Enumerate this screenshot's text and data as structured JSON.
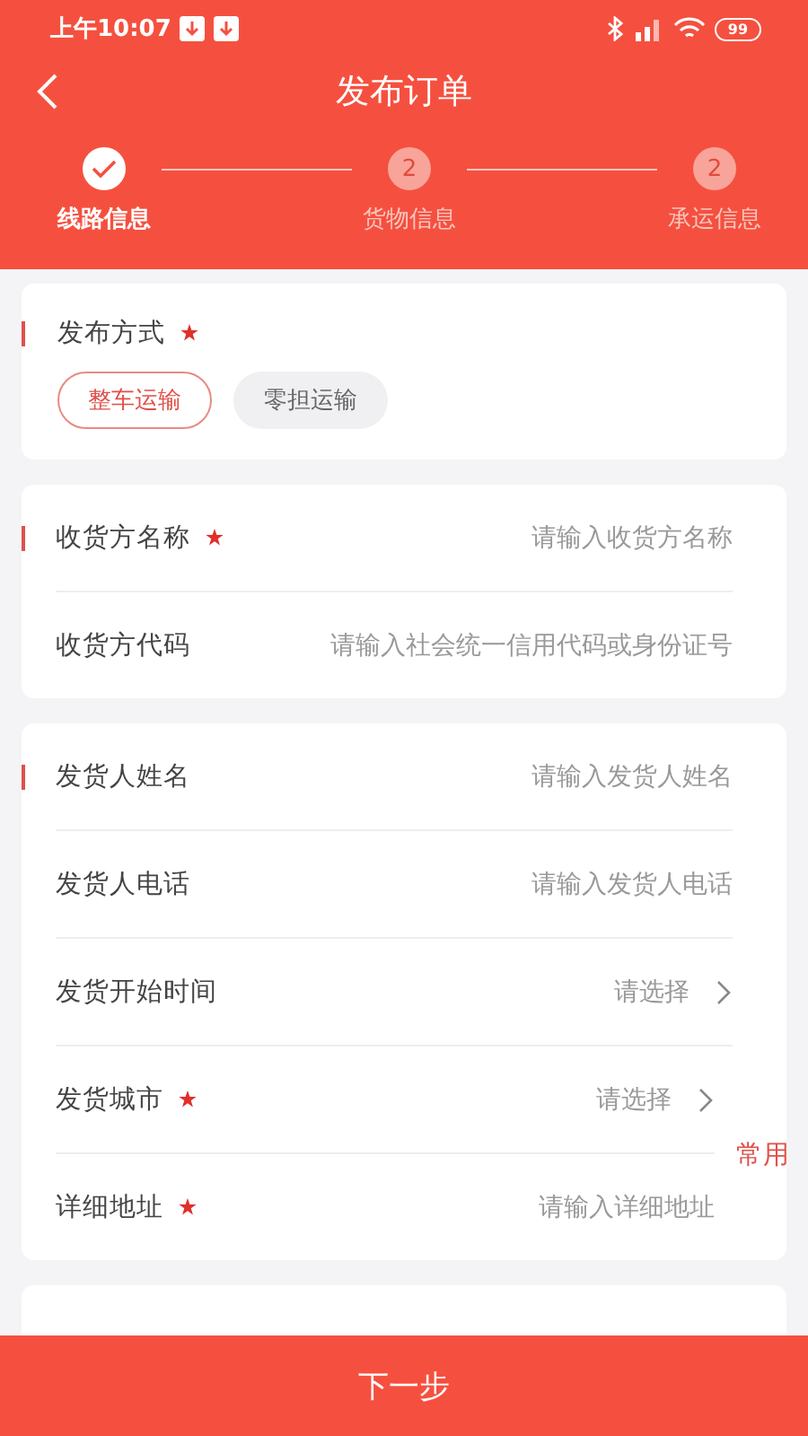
{
  "status_bar": {
    "time": "上午10:07",
    "battery": "99"
  },
  "header": {
    "title": "发布订单"
  },
  "steps": [
    {
      "label": "线路信息",
      "done": true
    },
    {
      "label": "货物信息",
      "done": false,
      "number": "2"
    },
    {
      "label": "承运信息",
      "done": false,
      "number": "2"
    }
  ],
  "publish_method": {
    "label": "发布方式",
    "required": true,
    "options": [
      {
        "label": "整车运输",
        "selected": true
      },
      {
        "label": "零担运输",
        "selected": false
      }
    ]
  },
  "sections": [
    {
      "rows": [
        {
          "kind": "input",
          "label": "收货方名称",
          "required": true,
          "placeholder": "请输入收货方名称"
        },
        {
          "kind": "input",
          "label": "收货方代码",
          "required": false,
          "placeholder": "请输入社会统一信用代码或身份证号"
        }
      ]
    },
    {
      "rows": [
        {
          "kind": "input",
          "label": "发货人姓名",
          "required": false,
          "placeholder": "请输入发货人姓名"
        },
        {
          "kind": "input",
          "label": "发货人电话",
          "required": false,
          "placeholder": "请输入发货人电话"
        },
        {
          "kind": "select",
          "label": "发货开始时间",
          "required": false,
          "value": "请选择"
        },
        {
          "kind": "group",
          "link": "常用",
          "rows": [
            {
              "kind": "select",
              "label": "发货城市",
              "required": true,
              "value": "请选择"
            },
            {
              "kind": "input",
              "label": "详细地址",
              "required": true,
              "placeholder": "请输入详细地址"
            }
          ]
        }
      ]
    }
  ],
  "next_button": "下一步"
}
